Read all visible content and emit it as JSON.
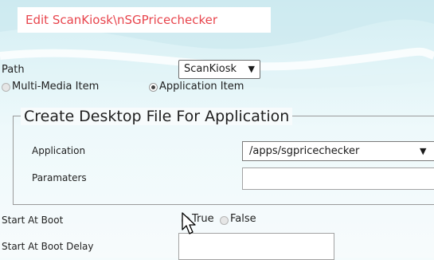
{
  "window": {
    "title": "Edit ScanKiosk\\nSGPricechecker"
  },
  "path": {
    "label": "Path",
    "selected": "ScanKiosk",
    "arrow": "▼"
  },
  "item_type": {
    "options": [
      {
        "label": "Multi-Media Item",
        "checked": false
      },
      {
        "label": "Application Item",
        "checked": true
      }
    ]
  },
  "create_desktop_file": {
    "legend": "Create Desktop File For Application",
    "application": {
      "label": "Application",
      "value": "/apps/sgpricechecker",
      "arrow": "▼"
    },
    "parameters": {
      "label": "Paramaters",
      "value": ""
    }
  },
  "start_at_boot": {
    "label": "Start At Boot",
    "options": [
      {
        "label": "True",
        "checked": true
      },
      {
        "label": "False",
        "checked": false
      }
    ]
  },
  "start_at_boot_delay": {
    "label": "Start At Boot Delay",
    "value": ""
  },
  "icons": {
    "cursor": "mouse-pointer-icon"
  },
  "colors": {
    "title_text": "#e8454d",
    "background": "#f4fbfc"
  }
}
